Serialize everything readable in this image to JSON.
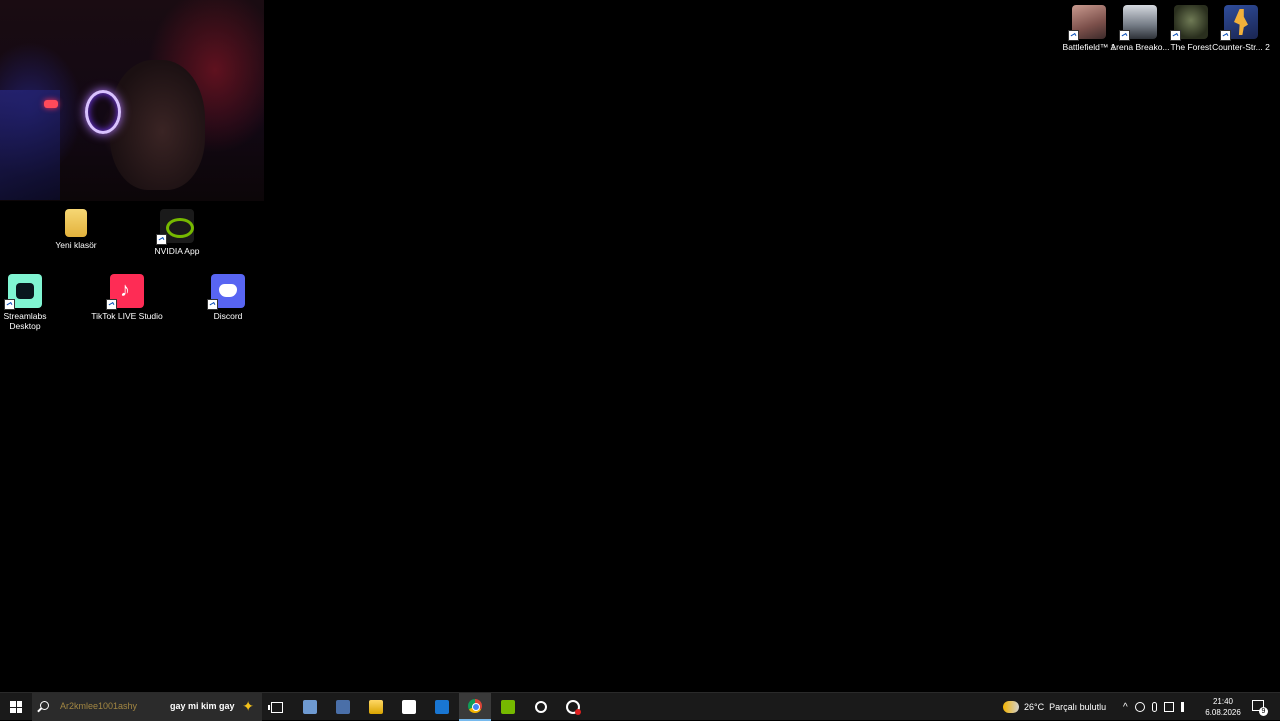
{
  "desktop": {
    "icons": [
      {
        "label": "Yeni klasör",
        "icon": "folder-icon"
      },
      {
        "label": "NVIDIA App",
        "icon": "nvidia-icon"
      },
      {
        "label": "Streamlabs Desktop",
        "icon": "streamlabs-icon"
      },
      {
        "label": "TikTok LIVE Studio",
        "icon": "tiktok-icon"
      },
      {
        "label": "Discord",
        "icon": "discord-icon"
      },
      {
        "label": "Battlefield™ 1",
        "icon": "battlefield-icon"
      },
      {
        "label": "Arena Breako...",
        "icon": "arena-breakout-icon"
      },
      {
        "label": "The Forest",
        "icon": "the-forest-icon"
      },
      {
        "label": "Counter-Str... 2",
        "icon": "counter-strike-icon"
      }
    ]
  },
  "taskbar": {
    "search_text": "gay mi kim gay",
    "search_ghost": "Ar2kmlee1001ashy",
    "weather": {
      "temp": "26°C",
      "condition": "Parçalı bulutlu"
    },
    "clock": {
      "time": "21:40",
      "date": "6.08.2026"
    },
    "notification_count": "9"
  },
  "colors": {
    "taskbar_bg": "#1a1a1a",
    "desktop_bg": "#000000",
    "accent": "#76b9ed"
  }
}
